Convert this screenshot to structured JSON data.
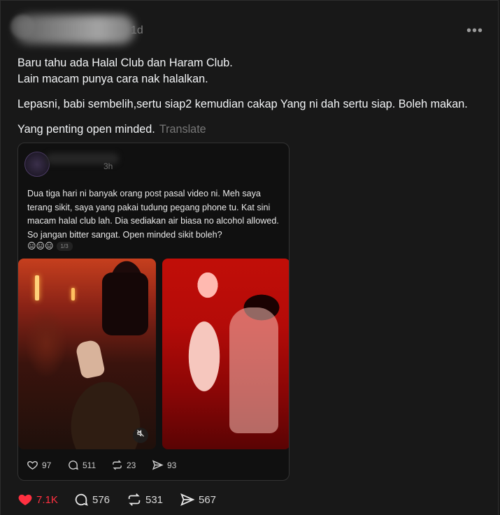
{
  "post": {
    "time": "1d",
    "more_label": "•••",
    "caption": [
      "Baru tahu ada Halal Club dan Haram Club.",
      "Lain macam punya cara nak halalkan.",
      "Lepasni, babi sembelih,sertu siap2 kemudian cakap Yang ni dah sertu siap. Boleh makan.",
      "Yang penting open minded."
    ],
    "translate_label": "Translate",
    "embed": {
      "time": "3h",
      "text": "Dua tiga hari ni banyak orang post pasal video ni. Meh saya terang sikit, saya yang pakai tudung pegang phone tu. Kat sini macam halal club lah. Dia sediakan air biasa no alcohol allowed. So jangan bitter sangat. Open minded sikit boleh?",
      "emojis": "😑😑😑",
      "page_indicator": "1/3",
      "actions": {
        "likes": "97",
        "replies": "511",
        "reposts": "23",
        "shares": "93"
      }
    },
    "actions": {
      "likes": "7.1K",
      "replies": "576",
      "reposts": "531",
      "shares": "567"
    }
  },
  "colors": {
    "like_red": "#ff3040",
    "background": "#181818",
    "text": "#f3f5f7",
    "muted": "#777777"
  },
  "icons": [
    "heart-icon",
    "comment-icon",
    "repost-icon",
    "share-icon",
    "mute-icon",
    "more-icon"
  ]
}
